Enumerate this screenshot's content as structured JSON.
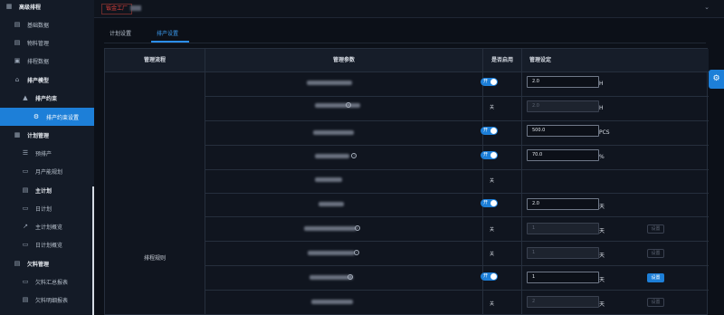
{
  "sidebar": {
    "items": [
      {
        "label": "高级排程",
        "icon": "grid-icon"
      },
      {
        "label": "基础数据",
        "icon": "table-icon"
      },
      {
        "label": "物料管理",
        "icon": "table-icon"
      },
      {
        "label": "排程数据",
        "icon": "calendar-icon"
      },
      {
        "label": "排产模型",
        "icon": "home-icon"
      },
      {
        "label": "排产约束",
        "icon": "warning-icon"
      },
      {
        "label": "排产约束设置",
        "icon": "gear-icon"
      },
      {
        "label": "计划管理",
        "icon": "grid-icon"
      },
      {
        "label": "预排产",
        "icon": "list-icon"
      },
      {
        "label": "月产能规划",
        "icon": "document-icon"
      },
      {
        "label": "主计划",
        "icon": "table-icon"
      },
      {
        "label": "日计划",
        "icon": "document-icon"
      },
      {
        "label": "主计划概览",
        "icon": "trend-icon"
      },
      {
        "label": "日计划概览",
        "icon": "monitor-icon"
      },
      {
        "label": "欠料管理",
        "icon": "document-icon"
      },
      {
        "label": "欠料汇总报表",
        "icon": "document-icon"
      },
      {
        "label": "欠料明细报表",
        "icon": "table-icon"
      }
    ]
  },
  "topbar": {
    "factory": "钣金工厂"
  },
  "tabs": [
    {
      "label": "计划设置"
    },
    {
      "label": "排产设置"
    }
  ],
  "table": {
    "headers": [
      "管理流程",
      "管理参数",
      "是否启用",
      "管理设定"
    ],
    "group_label": "排程规则",
    "on_label": "开",
    "off_label": "关",
    "set_label": "设置",
    "rows": [
      {
        "enabled": true,
        "value": "2.0",
        "unit": "H",
        "disabled": false
      },
      {
        "enabled": false,
        "value": "2.0",
        "unit": "H",
        "disabled": true
      },
      {
        "enabled": true,
        "value": "500.0",
        "unit": "PCS",
        "disabled": false
      },
      {
        "enabled": true,
        "value": "70.0",
        "unit": "%",
        "disabled": false
      },
      {
        "enabled": false,
        "value": "",
        "unit": "",
        "disabled": false
      },
      {
        "enabled": true,
        "value": "2.0",
        "unit": "天",
        "disabled": false
      },
      {
        "enabled": false,
        "value": "1",
        "unit": "天",
        "disabled": true
      },
      {
        "enabled": false,
        "value": "1",
        "unit": "天",
        "disabled": true
      },
      {
        "enabled": true,
        "value": "1",
        "unit": "天",
        "disabled": false
      },
      {
        "enabled": false,
        "value": "2",
        "unit": "天",
        "disabled": true
      }
    ]
  },
  "colors": {
    "accent": "#1d7fd8",
    "sidebar_bg": "#141b27",
    "page_bg": "#0c1018",
    "factory_red": "#e0413b"
  }
}
